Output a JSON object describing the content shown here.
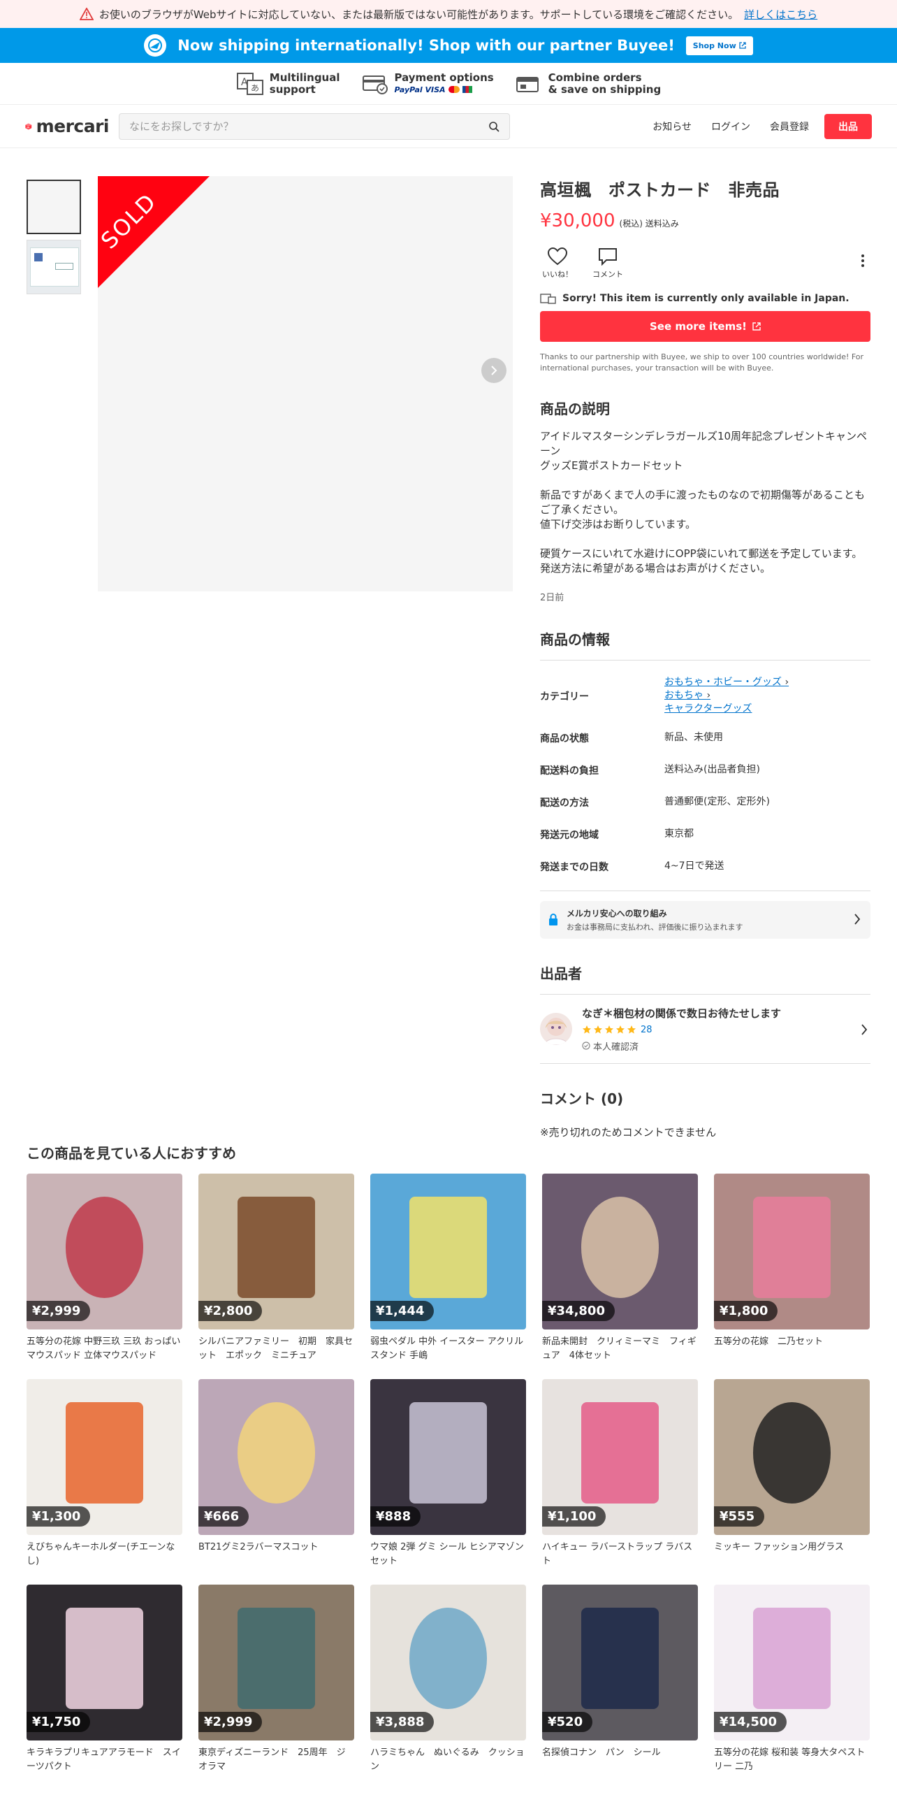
{
  "warning": {
    "text": "お使いのブラウザがWebサイトに対応していない、または最新版ではない可能性があります。サポートしている環境をご確認ください。",
    "link": "詳しくはこちら"
  },
  "shipping": {
    "text": "Now shipping internationally! Shop with our partner Buyee!",
    "button": "Shop Now"
  },
  "features": [
    {
      "title1": "Multilingual",
      "title2": "support"
    },
    {
      "title1": "Payment options",
      "title2": "PayPal  VISA"
    },
    {
      "title1": "Combine orders",
      "title2": "& save on shipping"
    }
  ],
  "header": {
    "logo": "mercari",
    "search_placeholder": "なにをお探しですか？",
    "news": "お知らせ",
    "login": "ログイン",
    "signup": "会員登録",
    "sell": "出品"
  },
  "product": {
    "sold_label": "SOLD",
    "title": "高垣楓　ポストカード　非売品",
    "price": "¥30,000",
    "price_note": "(税込) 送料込み",
    "like": "いいね！",
    "comment": "コメント",
    "japan_notice": "Sorry! This item is currently only available in Japan.",
    "see_more": "See more items!",
    "buyee_note": "Thanks to our partnership with Buyee, we ship to over 100 countries worldwide! For international purchases, your transaction will be with Buyee.",
    "desc_heading": "商品の説明",
    "description": [
      "アイドルマスターシンデレラガールズ10周年記念プレゼントキャンペーン",
      "グッズE賞ポストカードセット",
      "",
      "新品ですがあくまで人の手に渡ったものなので初期傷等があることもご了承ください。",
      "値下げ交渉はお断りしています。",
      "",
      "硬質ケースにいれて水避けにOPP袋にいれて郵送を予定しています。",
      "発送方法に希望がある場合はお声がけください。"
    ],
    "posted": "2日前",
    "info_heading": "商品の情報",
    "category_label": "カテゴリー",
    "categories": [
      "おもちゃ・ホビー・グッズ",
      "おもちゃ",
      "キャラクターグッズ"
    ],
    "info": [
      {
        "k": "商品の状態",
        "v": "新品、未使用"
      },
      {
        "k": "配送料の負担",
        "v": "送料込み(出品者負担)"
      },
      {
        "k": "配送の方法",
        "v": "普通郵便(定形、定形外)"
      },
      {
        "k": "発送元の地域",
        "v": "東京都"
      },
      {
        "k": "発送までの日数",
        "v": "4~7日で発送"
      }
    ],
    "secure_title": "メルカリ安心への取り組み",
    "secure_sub": "お金は事務局に支払われ、評価後に振り込まれます",
    "seller_heading": "出品者",
    "seller_name": "なぎ＊梱包材の関係で数日お待たせします",
    "seller_rating_count": "28",
    "seller_rating": 5,
    "seller_verified": "本人確認済",
    "comments_heading": "コメント (0)",
    "comments_closed": "※売り切れのためコメントできません"
  },
  "recommend": {
    "heading": "この商品を見ている人におすすめ",
    "items": [
      {
        "price": "¥2,999",
        "name": "五等分の花嫁 中野三玖 三玖 おっぱい マウスパッド 立体マウスパッド",
        "bg": "#c9b3b6",
        "fg": "#c0394b"
      },
      {
        "price": "¥2,800",
        "name": "シルバニアファミリー　初期　家具セット　エポック　ミニチュア",
        "bg": "#cdbfa9",
        "fg": "#7a4a2a"
      },
      {
        "price": "¥1,444",
        "name": "弱虫ペダル 中外 イースター アクリルスタンド 手嶋",
        "bg": "#5aa8d8",
        "fg": "#f2e26a"
      },
      {
        "price": "¥34,800",
        "name": "新品未開封　クリィミーマミ　フィギュア　4体セット",
        "bg": "#6b5a6e",
        "fg": "#d9c2a8"
      },
      {
        "price": "¥1,800",
        "name": "五等分の花嫁　二乃セット",
        "bg": "#b08a86",
        "fg": "#e97c9b"
      },
      {
        "price": "¥1,300",
        "name": "えびちゃんキーホルダー(チエーンなし)",
        "bg": "#f0ede8",
        "fg": "#e8642b"
      },
      {
        "price": "¥666",
        "name": "BT21グミ2ラバーマスコット",
        "bg": "#bca7b7",
        "fg": "#f2d37c"
      },
      {
        "price": "¥888",
        "name": "ウマ娘 2弾 グミ シール ヒシアマゾン セット",
        "bg": "#3a3440",
        "fg": "#c9c4d6"
      },
      {
        "price": "¥1,100",
        "name": "ハイキュー ラバーストラップ ラバスト",
        "bg": "#e7e2df",
        "fg": "#e45c88"
      },
      {
        "price": "¥555",
        "name": "ミッキー ファッション用グラス",
        "bg": "#b8a692",
        "fg": "#222222"
      },
      {
        "price": "¥1,750",
        "name": "キラキラプリキュアアラモード　スイーツパクト",
        "bg": "#2f2b30",
        "fg": "#f3d7e4"
      },
      {
        "price": "¥2,999",
        "name": "東京ディズニーランド　25周年　ジオラマ",
        "bg": "#8a7a68",
        "fg": "#3f6b6e"
      },
      {
        "price": "¥3,888",
        "name": "ハラミちゃん　ぬいぐるみ　クッション",
        "bg": "#e6e2dc",
        "fg": "#6fa8c8"
      },
      {
        "price": "¥520",
        "name": "名探偵コナン　パン　シール",
        "bg": "#5d5a60",
        "fg": "#1d2a4a"
      },
      {
        "price": "¥14,500",
        "name": "五等分の花嫁 桜和装 等身大タペストリー 二乃",
        "bg": "#f4eff4",
        "fg": "#d8a2d4"
      }
    ]
  }
}
